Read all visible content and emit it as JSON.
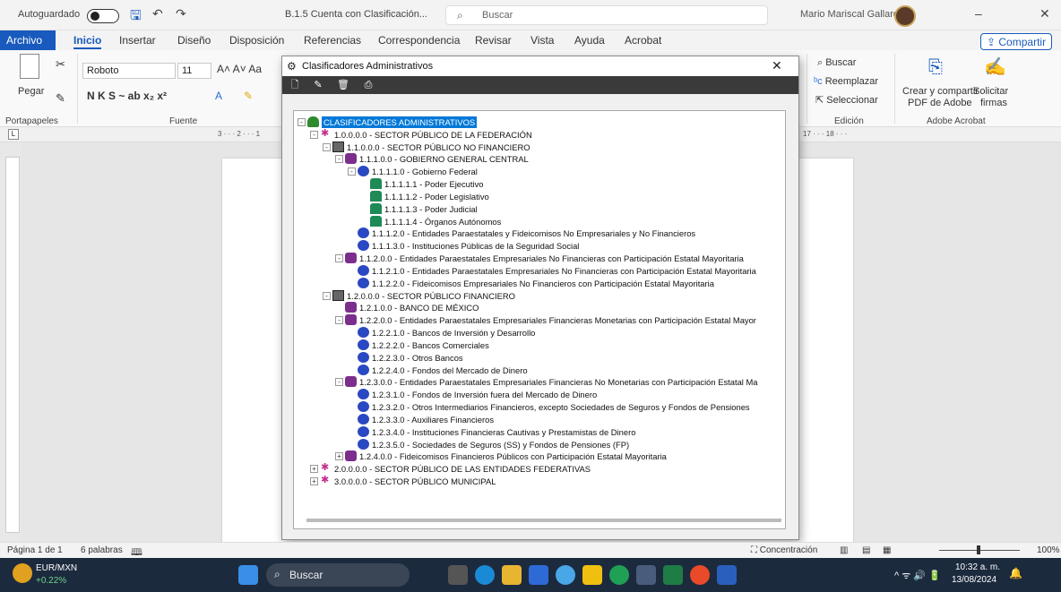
{
  "titlebar": {
    "autosave": "Autoguardado",
    "doc_title": "B.1.5 Cuenta con Clasificación...",
    "search_placeholder": "Buscar",
    "user": "Mario Mariscal Gallardo"
  },
  "menu": {
    "archivo": "Archivo",
    "items": [
      "Inicio",
      "Insertar",
      "Diseño",
      "Disposición",
      "Referencias",
      "Correspondencia",
      "Revisar",
      "Vista",
      "Ayuda",
      "Acrobat"
    ],
    "share": "Compartir"
  },
  "ribbon": {
    "paste": "Pegar",
    "font_name": "Roboto",
    "font_size": "11",
    "format_row": "N  K  S  ~  ab  x₂  x²",
    "groups": {
      "clipboard": "Portapapeles",
      "font": "Fuente",
      "editing": "Edición",
      "acrobat": "Adobe Acrobat"
    },
    "find": "Buscar",
    "replace": "Reemplazar",
    "select": "Seleccionar",
    "create_share": "Crear y compartir",
    "pdf_adobe": "PDF de Adobe",
    "request": "Solicitar",
    "signatures": "firmas"
  },
  "ruler": {
    "left": "3 · · · 2 · · · 1",
    "right": "17 · · · 18 · · ·"
  },
  "dialog": {
    "title": "Clasificadores Administrativos",
    "close": "✕",
    "tree": [
      {
        "level": 0,
        "icon": "tree",
        "exp": "-",
        "label": "CLASIFICADORES ADMINISTRATIVOS",
        "selected": true
      },
      {
        "level": 1,
        "icon": "star",
        "exp": "-",
        "label": "1.0.0.0.0 - SECTOR PÚBLICO DE LA FEDERACIÓN"
      },
      {
        "level": 2,
        "icon": "build",
        "exp": "-",
        "label": "1.1.0.0.0 - SECTOR PÚBLICO NO FINANCIERO"
      },
      {
        "level": 3,
        "icon": "gear",
        "exp": "-",
        "label": "1.1.1.0.0 - GOBIERNO GENERAL CENTRAL"
      },
      {
        "level": 4,
        "icon": "globe",
        "exp": "-",
        "label": "1.1.1.1.0 - Gobierno Federal"
      },
      {
        "level": 5,
        "icon": "person",
        "exp": "",
        "label": "1.1.1.1.1 - Poder Ejecutivo"
      },
      {
        "level": 5,
        "icon": "person",
        "exp": "",
        "label": "1.1.1.1.2 - Poder Legislativo"
      },
      {
        "level": 5,
        "icon": "person",
        "exp": "",
        "label": "1.1.1.1.3 - Poder Judicial"
      },
      {
        "level": 5,
        "icon": "person",
        "exp": "",
        "label": "1.1.1.1.4 - Órganos Autónomos"
      },
      {
        "level": 4,
        "icon": "globe",
        "exp": "",
        "label": "1.1.1.2.0 - Entidades Paraestatales y Fideicomisos No Empresariales y No Financieros"
      },
      {
        "level": 4,
        "icon": "globe",
        "exp": "",
        "label": "1.1.1.3.0 - Instituciones Públicas de la Seguridad Social"
      },
      {
        "level": 3,
        "icon": "gear",
        "exp": "-",
        "label": "1.1.2.0.0 - Entidades Paraestatales Empresariales No Financieras con Participación Estatal Mayoritaria"
      },
      {
        "level": 4,
        "icon": "globe",
        "exp": "",
        "label": "1.1.2.1.0 - Entidades Paraestatales Empresariales No Financieras con Participación Estatal Mayoritaria"
      },
      {
        "level": 4,
        "icon": "globe",
        "exp": "",
        "label": "1.1.2.2.0 - Fideicomisos Empresariales No Financieros con Participación Estatal Mayoritaria"
      },
      {
        "level": 2,
        "icon": "build",
        "exp": "-",
        "label": "1.2.0.0.0 - SECTOR PÚBLICO FINANCIERO"
      },
      {
        "level": 3,
        "icon": "gear",
        "exp": "",
        "label": "1.2.1.0.0 - BANCO DE MÉXICO"
      },
      {
        "level": 3,
        "icon": "gear",
        "exp": "-",
        "label": "1.2.2.0.0 - Entidades Paraestatales Empresariales Financieras Monetarias con Participación Estatal Mayor"
      },
      {
        "level": 4,
        "icon": "globe",
        "exp": "",
        "label": "1.2.2.1.0 - Bancos de Inversión y Desarrollo"
      },
      {
        "level": 4,
        "icon": "globe",
        "exp": "",
        "label": "1.2.2.2.0 - Bancos Comerciales"
      },
      {
        "level": 4,
        "icon": "globe",
        "exp": "",
        "label": "1.2.2.3.0 - Otros Bancos"
      },
      {
        "level": 4,
        "icon": "globe",
        "exp": "",
        "label": "1.2.2.4.0 - Fondos del Mercado de Dinero"
      },
      {
        "level": 3,
        "icon": "gear",
        "exp": "-",
        "label": "1.2.3.0.0 - Entidades Paraestatales Empresariales Financieras No Monetarias con Participación Estatal Ma"
      },
      {
        "level": 4,
        "icon": "globe",
        "exp": "",
        "label": "1.2.3.1.0 - Fondos de Inversión fuera del Mercado de Dinero"
      },
      {
        "level": 4,
        "icon": "globe",
        "exp": "",
        "label": "1.2.3.2.0 - Otros Intermediarios Financieros, excepto Sociedades de Seguros y Fondos de Pensiones"
      },
      {
        "level": 4,
        "icon": "globe",
        "exp": "",
        "label": "1.2.3.3.0 - Auxiliares Financieros"
      },
      {
        "level": 4,
        "icon": "globe",
        "exp": "",
        "label": "1.2.3.4.0 - Instituciones Financieras Cautivas y Prestamistas de Dinero"
      },
      {
        "level": 4,
        "icon": "globe",
        "exp": "",
        "label": "1.2.3.5.0 - Sociedades de Seguros (SS) y Fondos de Pensiones (FP)"
      },
      {
        "level": 3,
        "icon": "gear",
        "exp": "+",
        "label": "1.2.4.0.0 - Fideicomisos Financieros Públicos con Participación Estatal Mayoritaria"
      },
      {
        "level": 1,
        "icon": "star",
        "exp": "+",
        "label": "2.0.0.0.0 - SECTOR PÚBLICO DE LAS ENTIDADES FEDERATIVAS"
      },
      {
        "level": 1,
        "icon": "star",
        "exp": "+",
        "label": "3.0.0.0.0 - SECTOR PÚBLICO MUNICIPAL"
      }
    ]
  },
  "status": {
    "page": "Página 1 de 1",
    "words": "6 palabras",
    "focus": "Concentración",
    "zoom": "100%"
  },
  "taskbar": {
    "currency": "EUR/MXN",
    "change": "+0.22%",
    "search": "Buscar",
    "time": "10:32 a. m.",
    "date": "13/08/2024"
  }
}
